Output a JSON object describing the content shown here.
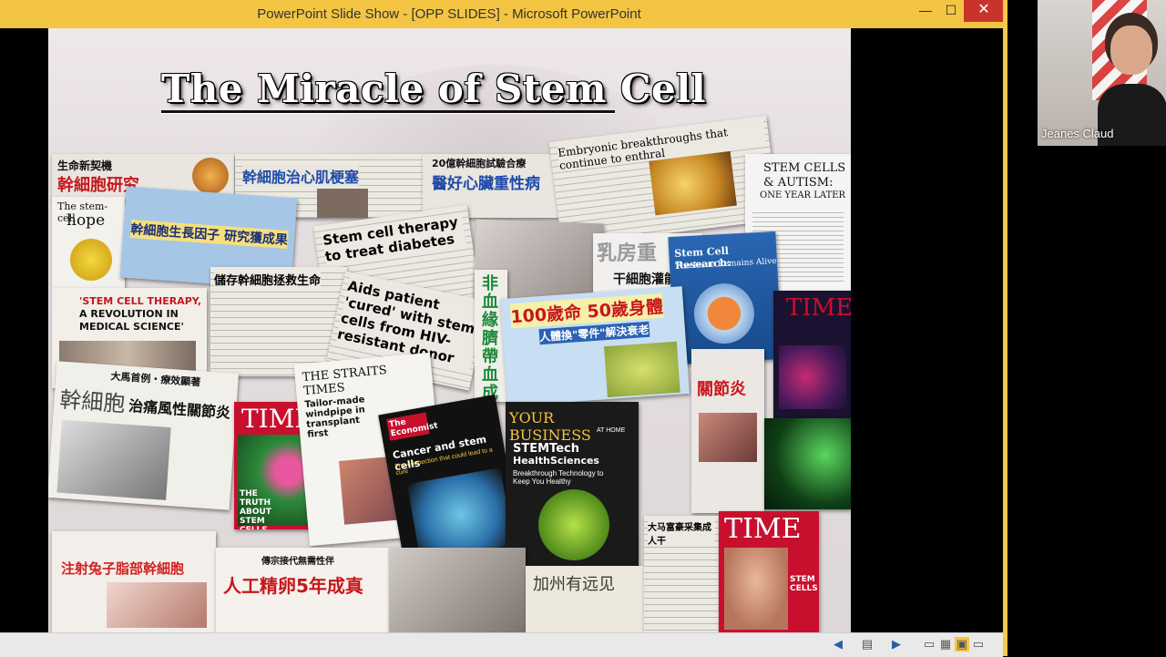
{
  "window": {
    "title": "PowerPoint Slide Show - [OPP SLIDES] - Microsoft PowerPoint",
    "minimize_glyph": "—",
    "maximize_glyph": "☐",
    "close_glyph": "✕"
  },
  "slide": {
    "title": "The Miracle of Stem Cell",
    "clippings": {
      "c1": "生命新契機",
      "c1b": "幹細胞研究",
      "c2": "幹細胞治心肌梗塞",
      "c3": "20億幹細胞試驗合療",
      "c3b": "醫好心臟重性病",
      "c4": "Embryonic breakthroughs that continue to enthral",
      "c5a": "STEM CELLS",
      "c5b": "& AUTISM:",
      "c5c": "ONE YEAR LATER",
      "c6a": "The stem-cell",
      "c6b": "hope",
      "c7": "幹細胞生長因子 研究獲成果",
      "c8": "Stem cell therapy to treat diabetes",
      "c9": "乳房重",
      "c9b": "干細胞灌能",
      "c10a": "Stem Cell Research:",
      "c10b": "The Issue Remains Alive",
      "c11": "儲存幹細胞拯救生命",
      "c12": "Aids patient 'cured' with stem cells from HIV-resistant donor",
      "c13": "非血緣臍帶血成功",
      "c14": "100歲命 50歲身體",
      "c14b": "人體換\"零件\"解決衰老",
      "c15": "TIME",
      "c16a": "'STEM CELL THERAPY,",
      "c16b": "A REVOLUTION IN",
      "c16c": "MEDICAL SCIENCE'",
      "c17a": "大馬首例・療效顯著",
      "c17b": "幹細胞",
      "c17c": "治痛風性關節炎",
      "c18": "THE STRAITS TIMES",
      "c18b": "Tailor-made windpipe in transplant first",
      "c19a": "The Economist",
      "c19b": "Cancer and stem cells",
      "c19c": "The connection that could lead to a cure",
      "c20a": "YOUR BUSINESS",
      "c20b": "AT HOME",
      "c20c": "STEMTech",
      "c20d": "HealthSciences",
      "c20e": "Breakthrough Technology to Keep You Healthy",
      "c21": "關節炎",
      "c22a": "TIME",
      "c22b": "THE TRUTH ABOUT STEM CELLS",
      "c23": "注射兔子脂部幹細胞",
      "c24a": "傳宗接代無需性伴",
      "c24b": "人工精卵5年成真",
      "c25": "加州有远见",
      "c26": "大马富豪采集成人干",
      "c27a": "TIME",
      "c27b": "STEM CELLS"
    }
  },
  "zoom": {
    "participant_name": "Jeanes Claud"
  },
  "colors": {
    "titlebar": "#f4c542",
    "close_button": "#c8342c",
    "time_red": "#c8102e"
  },
  "status_icons": [
    "prev-arrow-icon",
    "notes-icon",
    "next-arrow-icon",
    "normal-view-icon",
    "slide-sorter-icon",
    "reading-view-icon",
    "slideshow-icon"
  ]
}
